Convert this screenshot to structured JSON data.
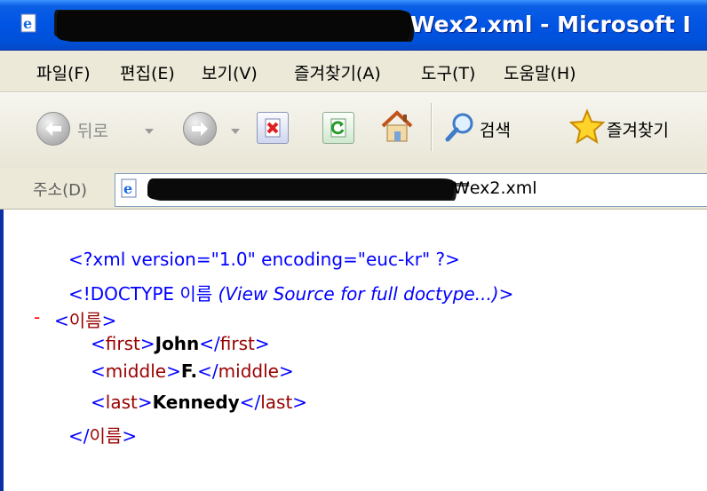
{
  "window": {
    "title": "Wex2.xml - Microsoft I",
    "accent": "#0054e3"
  },
  "menu": {
    "items": [
      "파일(F)",
      "편집(E)",
      "보기(V)",
      "즐겨찾기(A)",
      "도구(T)",
      "도움말(H)"
    ]
  },
  "toolbar": {
    "back_label": "뒤로",
    "search_label": "검색",
    "favorites_label": "즐겨찾기",
    "icons": [
      "back-arrow-icon",
      "forward-arrow-icon",
      "stop-icon",
      "refresh-icon",
      "home-icon",
      "search-icon",
      "favorites-star-icon"
    ]
  },
  "address": {
    "label": "주소(D)",
    "value_suffix": "₩ex2.xml"
  },
  "xml": {
    "declaration": "<?xml version=\"1.0\" encoding=\"euc-kr\" ?>",
    "doctype_prefix": "<!DOCTYPE 이름 ",
    "doctype_note": "(View Source for full doctype...)",
    "doctype_suffix": ">",
    "collapse_marker": "-",
    "root_open": "<이름>",
    "root_close": "</이름>",
    "children": [
      {
        "tag": "first",
        "value": "John"
      },
      {
        "tag": "middle",
        "value": "F."
      },
      {
        "tag": "last",
        "value": "Kennedy"
      }
    ]
  }
}
